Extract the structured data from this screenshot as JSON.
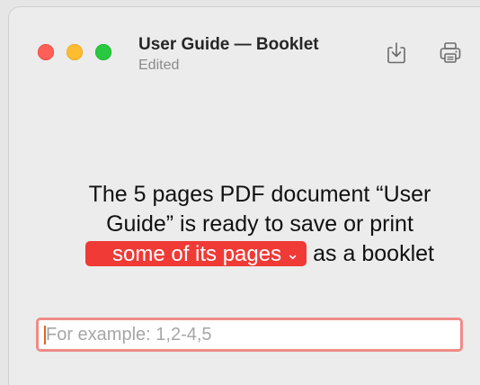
{
  "window": {
    "title": "User Guide — Booklet",
    "subtitle": "Edited"
  },
  "toolbar": {
    "save_icon": "save-download-icon",
    "print_icon": "printer-icon"
  },
  "message": {
    "line1": "The 5 pages PDF document “User",
    "line2": "Guide” is ready to save or print",
    "popup_value": "some of its pages",
    "popup_chevron": "⌄",
    "line3_suffix": "as a booklet"
  },
  "range_input": {
    "value": "",
    "placeholder": "For example: 1,2-4,5"
  },
  "colors": {
    "accent": "#f03a36",
    "focus_ring": "#f08b88",
    "close": "#ff5f57",
    "minimize": "#febc2e",
    "zoom": "#28c840"
  }
}
